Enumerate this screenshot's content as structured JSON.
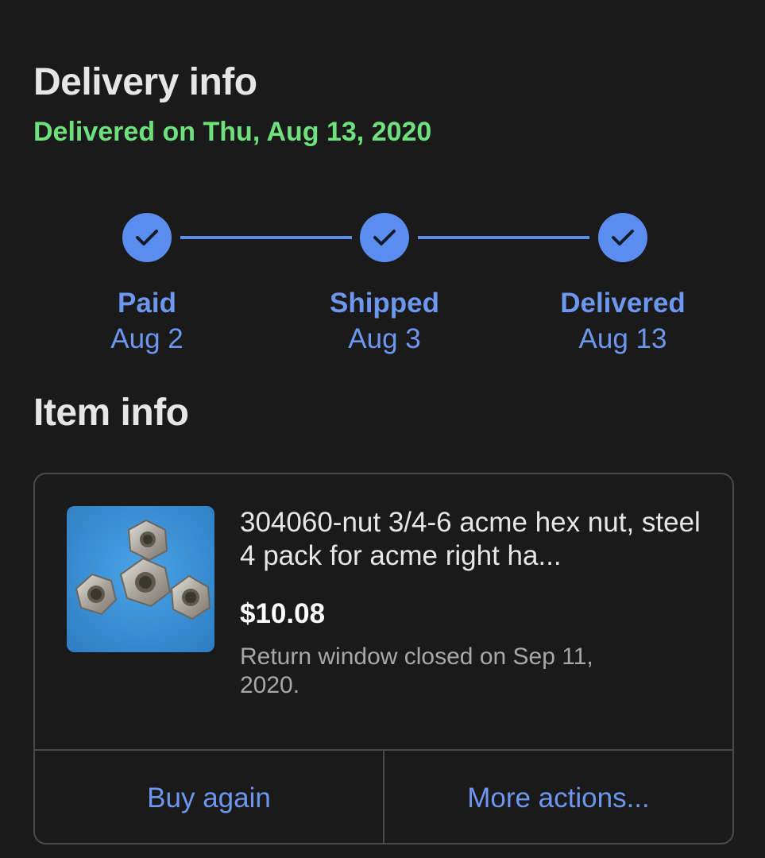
{
  "delivery": {
    "title": "Delivery info",
    "status": "Delivered on Thu, Aug 13, 2020",
    "status_color": "#6ee07c",
    "accent_color": "#5b8def",
    "steps": [
      {
        "name": "Paid",
        "date": "Aug 2",
        "icon": "checkmark-icon",
        "complete": true
      },
      {
        "name": "Shipped",
        "date": "Aug 3",
        "icon": "checkmark-icon",
        "complete": true
      },
      {
        "name": "Delivered",
        "date": "Aug 13",
        "icon": "checkmark-icon",
        "complete": true
      }
    ]
  },
  "item_info": {
    "title": "Item info",
    "item": {
      "name": "304060-nut 3/4-6 acme hex nut, steel 4 pack for acme right ha...",
      "price": "$10.08",
      "return_status": "Return window closed on Sep 11, 2020.",
      "image": "hex-nuts-photo"
    },
    "actions": {
      "buy_again": "Buy again",
      "more_actions": "More actions..."
    }
  }
}
